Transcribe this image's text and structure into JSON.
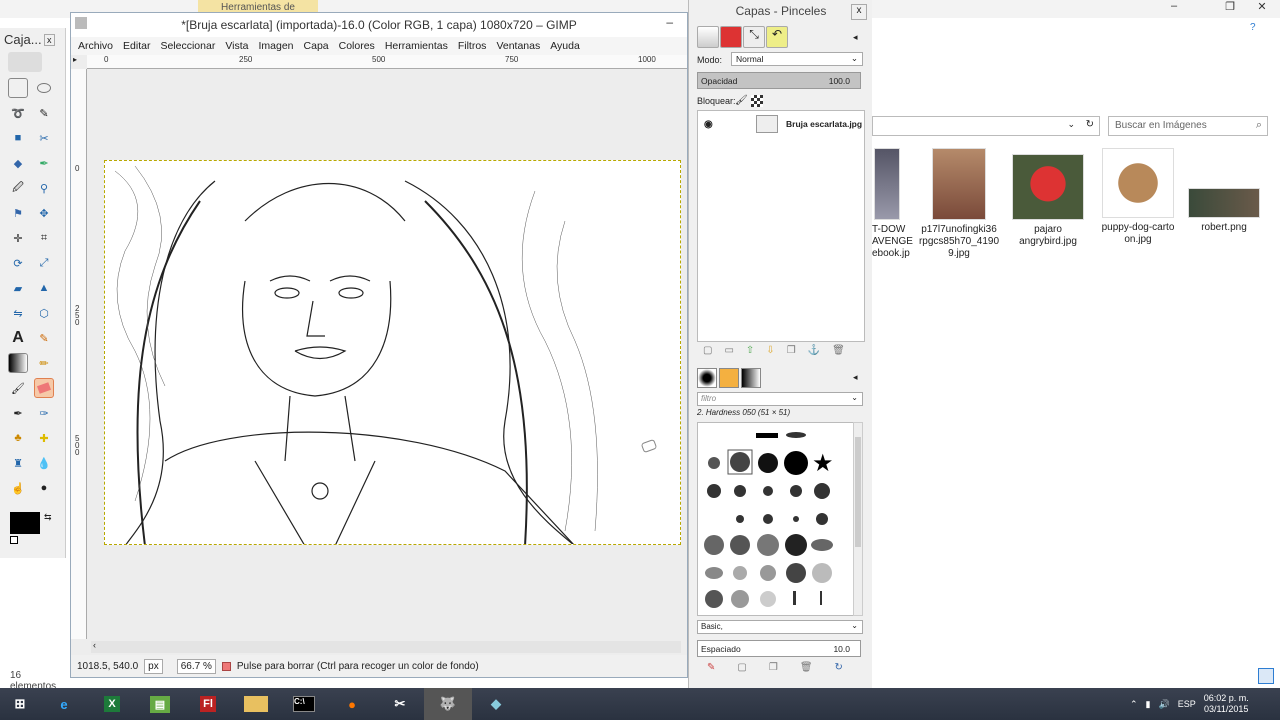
{
  "explorer": {
    "tool_tab": "Herramientas de imagen",
    "search_placeholder": "Buscar en Imágenes",
    "status": "16 elementos",
    "files": [
      {
        "name": "T-DOW\nAVENGE\nebook.jp"
      },
      {
        "name": "p17l7unofingki36\nrpgcs85h70_4190\n9.jpg"
      },
      {
        "name": "pajaro\nangrybird.jpg"
      },
      {
        "name": "puppy-dog-carto\non.jpg"
      },
      {
        "name": "robert.png"
      }
    ]
  },
  "toolbox": {
    "title": "Caja..."
  },
  "image_window": {
    "title": "*[Bruja escarlata] (importada)-16.0 (Color RGB, 1 capa) 1080x720 – GIMP",
    "menu": [
      "Archivo",
      "Editar",
      "Seleccionar",
      "Vista",
      "Imagen",
      "Capa",
      "Colores",
      "Herramientas",
      "Filtros",
      "Ventanas",
      "Ayuda"
    ],
    "ruler_h": [
      "0",
      "250",
      "500",
      "750",
      "1000"
    ],
    "ruler_v": [
      "0",
      "250",
      "500"
    ],
    "status": {
      "coords": "1018.5, 540.0",
      "unit": "px",
      "zoom": "66.7 %",
      "message": "Pulse para borrar (Ctrl para recoger un color de fondo)"
    }
  },
  "dock": {
    "title": "Capas - Pinceles",
    "mode_label": "Modo:",
    "mode_value": "Normal",
    "opacity_label": "Opacidad",
    "opacity_value": "100.0",
    "lock_label": "Bloquear:",
    "layer_name": "Bruja escarlata.jpg",
    "brush_filter_placeholder": "filtro",
    "brush_name": "2. Hardness 050 (51 × 51)",
    "tag": "Basic,",
    "spacing_label": "Espaciado",
    "spacing_value": "10.0"
  },
  "taskbar": {
    "lang": "ESP",
    "time": "06:02 p. m.",
    "date": "03/11/2015",
    "apps": [
      "windows-start",
      "ie",
      "excel",
      "sheets",
      "flash",
      "explorer",
      "cmd",
      "firefox",
      "tools",
      "gimp",
      "app"
    ]
  },
  "colors": {
    "accent": "#2d7dd2",
    "fg": "#000000",
    "bg": "#ffffff"
  }
}
